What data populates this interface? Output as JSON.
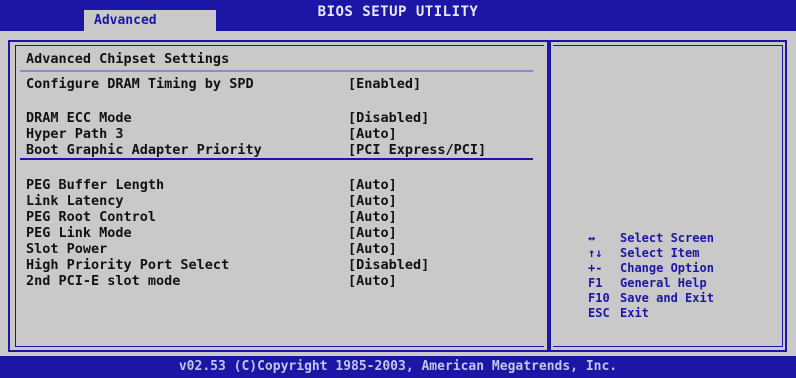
{
  "header": {
    "title": "BIOS SETUP UTILITY",
    "active_tab": "Advanced"
  },
  "main": {
    "section_title": "Advanced Chipset Settings",
    "rows": [
      {
        "label": "Configure DRAM Timing by SPD",
        "value": "[Enabled]"
      },
      {
        "label": "DRAM ECC Mode",
        "value": "[Disabled]"
      },
      {
        "label": "Hyper Path 3",
        "value": "[Auto]"
      },
      {
        "label": "Boot Graphic Adapter Priority",
        "value": "[PCI Express/PCI]"
      },
      {
        "label": "PEG Buffer Length",
        "value": "[Auto]"
      },
      {
        "label": "Link Latency",
        "value": "[Auto]"
      },
      {
        "label": "PEG Root Control",
        "value": "[Auto]"
      },
      {
        "label": "PEG Link Mode",
        "value": "[Auto]"
      },
      {
        "label": "Slot Power",
        "value": "[Auto]"
      },
      {
        "label": "High Priority Port Select",
        "value": "[Disabled]"
      },
      {
        "label": "2nd PCI-E slot mode",
        "value": "[Auto]"
      }
    ]
  },
  "help": {
    "items": [
      {
        "key": "↔",
        "desc": "Select Screen"
      },
      {
        "key": "↑↓",
        "desc": "Select Item"
      },
      {
        "key": "+-",
        "desc": "Change Option"
      },
      {
        "key": "F1",
        "desc": "General Help"
      },
      {
        "key": "F10",
        "desc": "Save and Exit"
      },
      {
        "key": "ESC",
        "desc": "Exit"
      }
    ]
  },
  "footer": {
    "copyright": "v02.53 (C)Copyright 1985-2003, American Megatrends, Inc."
  },
  "colors": {
    "bios_blue": "#1b16a6",
    "panel_gray": "#c9c9c9",
    "text_dark": "#121212"
  }
}
